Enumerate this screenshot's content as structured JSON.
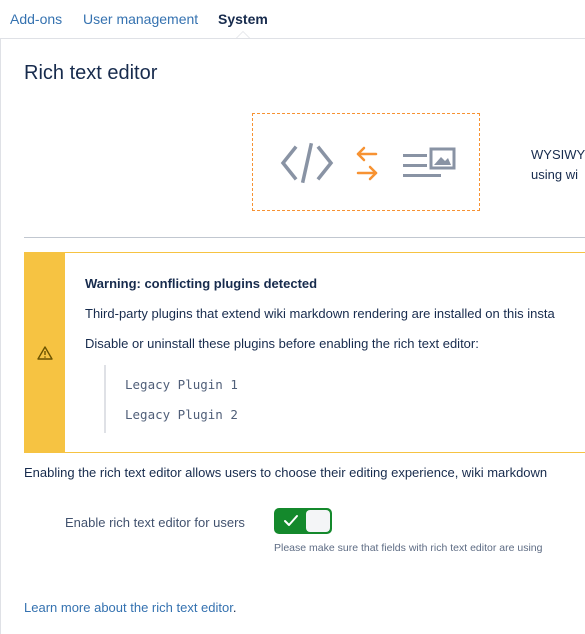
{
  "tabs": [
    {
      "label": "Add-ons"
    },
    {
      "label": "User management"
    },
    {
      "label": "System"
    }
  ],
  "page": {
    "title": "Rich text editor"
  },
  "illustration": {
    "icons": [
      "code-icon",
      "swap-arrows-icon",
      "rich-text-image-icon"
    ],
    "accent_color": "#f79232",
    "text_line1": "WYSIWY",
    "text_line2": "using wi"
  },
  "warning": {
    "title": "Warning: conflicting plugins detected",
    "line1": "Third-party plugins that extend wiki markdown rendering are installed on this insta",
    "line2": "Disable or uninstall these plugins before enabling the rich text editor:",
    "plugins": [
      "Legacy Plugin 1",
      "Legacy Plugin 2"
    ],
    "bar_color": "#f6c342"
  },
  "description": "Enabling the rich text editor allows users to choose their editing experience, wiki markdown",
  "setting": {
    "label": "Enable rich text editor for users",
    "enabled": true,
    "help": "Please make sure that fields with rich text editor are using"
  },
  "learn_more": {
    "link": "Learn more about the rich text editor",
    "suffix": "."
  }
}
